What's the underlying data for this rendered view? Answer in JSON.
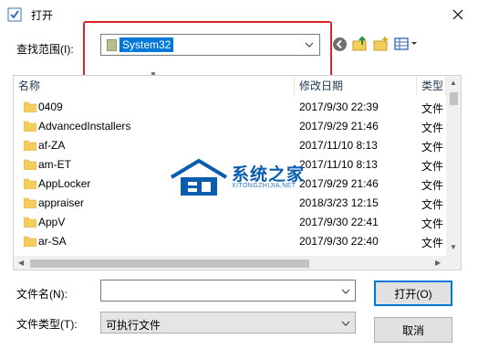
{
  "window": {
    "title": "打开"
  },
  "toolbar": {
    "lookin_label": "查找范围(I):",
    "lookin_value": "System32"
  },
  "list": {
    "columns": [
      "名称",
      "修改日期",
      "类型"
    ],
    "rows": [
      {
        "name": "0409",
        "date": "2017/9/30 22:39",
        "type": "文件"
      },
      {
        "name": "AdvancedInstallers",
        "date": "2017/9/29 21:46",
        "type": "文件"
      },
      {
        "name": "af-ZA",
        "date": "2017/11/10 8:13",
        "type": "文件"
      },
      {
        "name": "am-ET",
        "date": "2017/11/10 8:13",
        "type": "文件"
      },
      {
        "name": "AppLocker",
        "date": "2017/9/29 21:46",
        "type": "文件"
      },
      {
        "name": "appraiser",
        "date": "2018/3/23 12:15",
        "type": "文件"
      },
      {
        "name": "AppV",
        "date": "2017/9/30 22:41",
        "type": "文件"
      },
      {
        "name": "ar-SA",
        "date": "2017/9/30 22:40",
        "type": "文件"
      }
    ]
  },
  "form": {
    "filename_label": "文件名(N):",
    "filename_value": "",
    "filetype_label": "文件类型(T):",
    "filetype_value": "可执行文件"
  },
  "buttons": {
    "open": "打开(O)",
    "cancel": "取消"
  },
  "watermark": {
    "main": "系统之家",
    "sub": "XITONGZHIJIA.NET"
  },
  "colors": {
    "accent": "#0078d7",
    "highlight": "#d9232d",
    "folder": "#f5cd5b"
  }
}
